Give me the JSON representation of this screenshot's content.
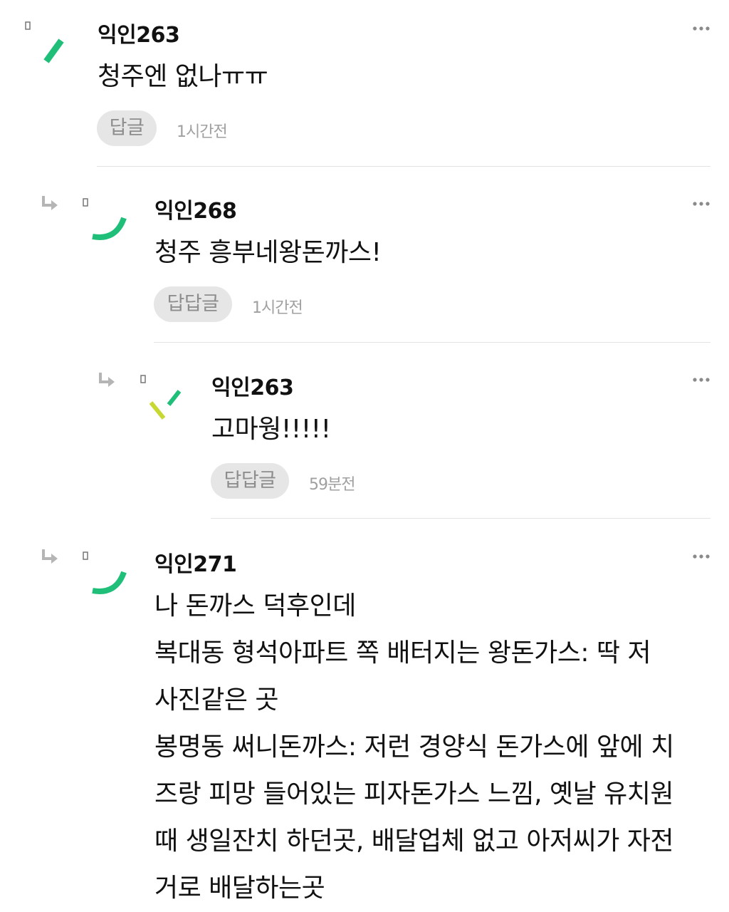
{
  "comments": [
    {
      "author": "익인263",
      "lines": [
        "청주엔 없나ㅠㅠ"
      ],
      "reply_label": "답글",
      "time": "1시간전",
      "avatar_icon": "green-stroke-avatar-icon"
    },
    {
      "author": "익인268",
      "lines": [
        "청주 흥부네왕돈까스!"
      ],
      "reply_label": "답답글",
      "time": "1시간전",
      "avatar_icon": "green-arc-avatar-icon"
    },
    {
      "author": "익인263",
      "lines": [
        "고마웡!!!!!"
      ],
      "reply_label": "답답글",
      "time": "59분전",
      "avatar_icon": "lime-strokes-avatar-icon"
    },
    {
      "author": "익인271",
      "lines": [
        "나 돈까스 덕후인데",
        "복대동 형석아파트 쪽 배터지는 왕돈가스: 딱 저",
        "사진같은 곳",
        "봉명동 써니돈까스: 저런 경양식 돈가스에 앞에 치",
        "즈랑 피망 들어있는 피자돈가스 느낌, 옛날 유치원",
        "때 생일잔치 하던곳, 배달업체 없고 아저씨가 자전",
        "거로 배달하는곳"
      ],
      "avatar_icon": "green-arc-avatar-icon"
    }
  ],
  "colors": {
    "avatar_green": "#1fbf7a",
    "avatar_lime": "#c8d832",
    "button_bg": "#e6e6e6",
    "button_text": "#8d8d8d",
    "time_text": "#a0a0a0",
    "divider": "#e3e3e3",
    "icon_gray": "#b5b5b5"
  }
}
